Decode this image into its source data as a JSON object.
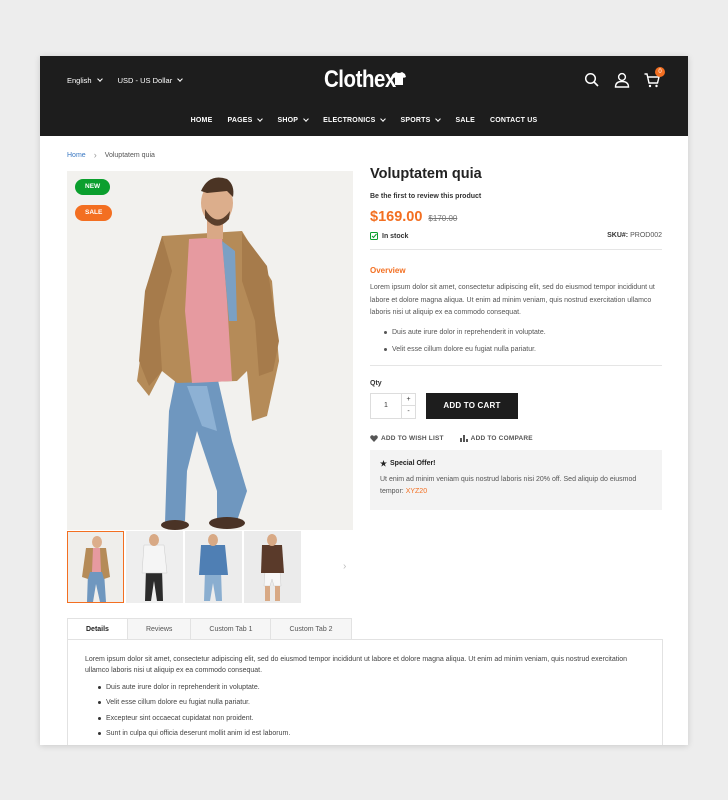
{
  "header": {
    "language": "English",
    "currency": "USD - US Dollar",
    "logo": "Clothex",
    "cart_count": "0",
    "nav": [
      {
        "label": "HOME",
        "has_dropdown": false
      },
      {
        "label": "PAGES",
        "has_dropdown": true
      },
      {
        "label": "SHOP",
        "has_dropdown": true
      },
      {
        "label": "ELECTRONICS",
        "has_dropdown": true
      },
      {
        "label": "SPORTS",
        "has_dropdown": true
      },
      {
        "label": "SALE",
        "has_dropdown": false
      },
      {
        "label": "CONTACT US",
        "has_dropdown": false
      }
    ]
  },
  "breadcrumb": {
    "home": "Home",
    "separator": "›",
    "current": "Voluptatem quia"
  },
  "gallery": {
    "badge_new": "NEW",
    "badge_sale": "SALE",
    "next_arrow": "›"
  },
  "product": {
    "title": "Voluptatem quia",
    "review_link": "Be the first to review this product",
    "price": "$169.00",
    "old_price": "$170.00",
    "stock": "In stock",
    "sku_label": "SKU#:",
    "sku_value": "PROD002",
    "overview_title": "Overview",
    "overview_text": "Lorem ipsum dolor sit amet, consectetur adipiscing elit, sed do eiusmod tempor incididunt ut labore et dolore magna aliqua. Ut enim ad minim veniam, quis nostrud exercitation ullamco laboris nisi ut aliquip ex ea commodo consequat.",
    "bullets": [
      "Duis aute irure dolor in reprehenderit in voluptate.",
      "Velit esse cillum dolore eu fugiat nulla pariatur."
    ],
    "qty_label": "Qty",
    "qty_value": "1",
    "qty_plus": "+",
    "qty_minus": "-",
    "add_to_cart": "ADD TO CART",
    "wishlist": "ADD TO WISH LIST",
    "compare": "ADD TO COMPARE",
    "offer_title": "Special Offer!",
    "offer_text": "Ut enim ad minim veniam quis nostrud laboris nisi 20% off. Sed aliquip do eiusmod tempor: ",
    "offer_code": "XYZ20"
  },
  "tabs": {
    "items": [
      "Details",
      "Reviews",
      "Custom Tab 1",
      "Custom Tab 2"
    ],
    "active": "Details",
    "details_text": "Lorem ipsum dolor sit amet, consectetur adipiscing elit, sed do eiusmod tempor incididunt ut labore et dolore magna aliqua. Ut enim ad minim veniam, quis nostrud exercitation ullamco laboris nisi ut aliquip ex ea commodo consequat.",
    "details_bullets": [
      "Duis aute irure dolor in reprehenderit in voluptate.",
      "Velit esse cillum dolore eu fugiat nulla pariatur.",
      "Excepteur sint occaecat cupidatat non proident.",
      "Sunt in culpa qui officia deserunt mollit anim id est laborum."
    ]
  },
  "colors": {
    "accent": "#f36f21",
    "header_bg": "#1d1d1d",
    "new_badge": "#0b9f2e",
    "link": "#3a78c3"
  }
}
